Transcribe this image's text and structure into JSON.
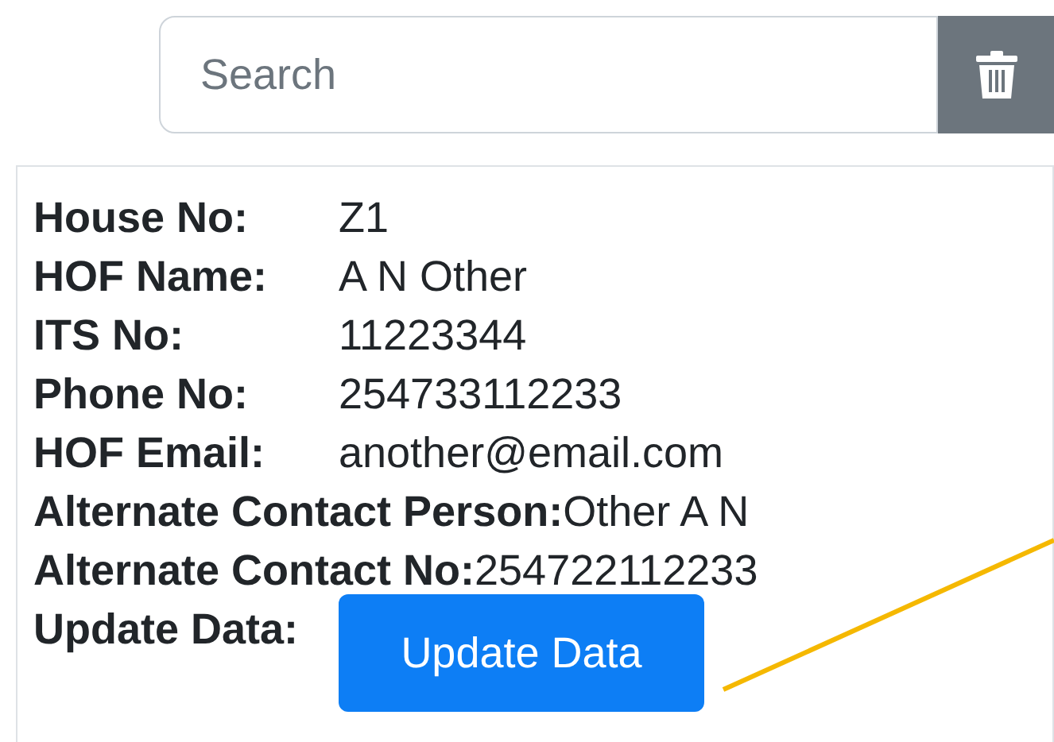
{
  "search": {
    "placeholder": "Search"
  },
  "details": [
    {
      "label": "House No:",
      "value": "Z1",
      "kind": "column"
    },
    {
      "label": "HOF Name:",
      "value": "A N Other",
      "kind": "column"
    },
    {
      "label": "ITS No:",
      "value": "11223344",
      "kind": "column"
    },
    {
      "label": "Phone No:",
      "value": "254733112233",
      "kind": "column"
    },
    {
      "label": "HOF Email:",
      "value": "another@email.com",
      "kind": "column"
    },
    {
      "label": "Alternate Contact Person:",
      "value": "Other A N",
      "kind": "inline"
    },
    {
      "label": "Alternate Contact No:",
      "value": "254722112233",
      "kind": "inline"
    }
  ],
  "update": {
    "label": "Update Data:",
    "button": "Update Data"
  }
}
